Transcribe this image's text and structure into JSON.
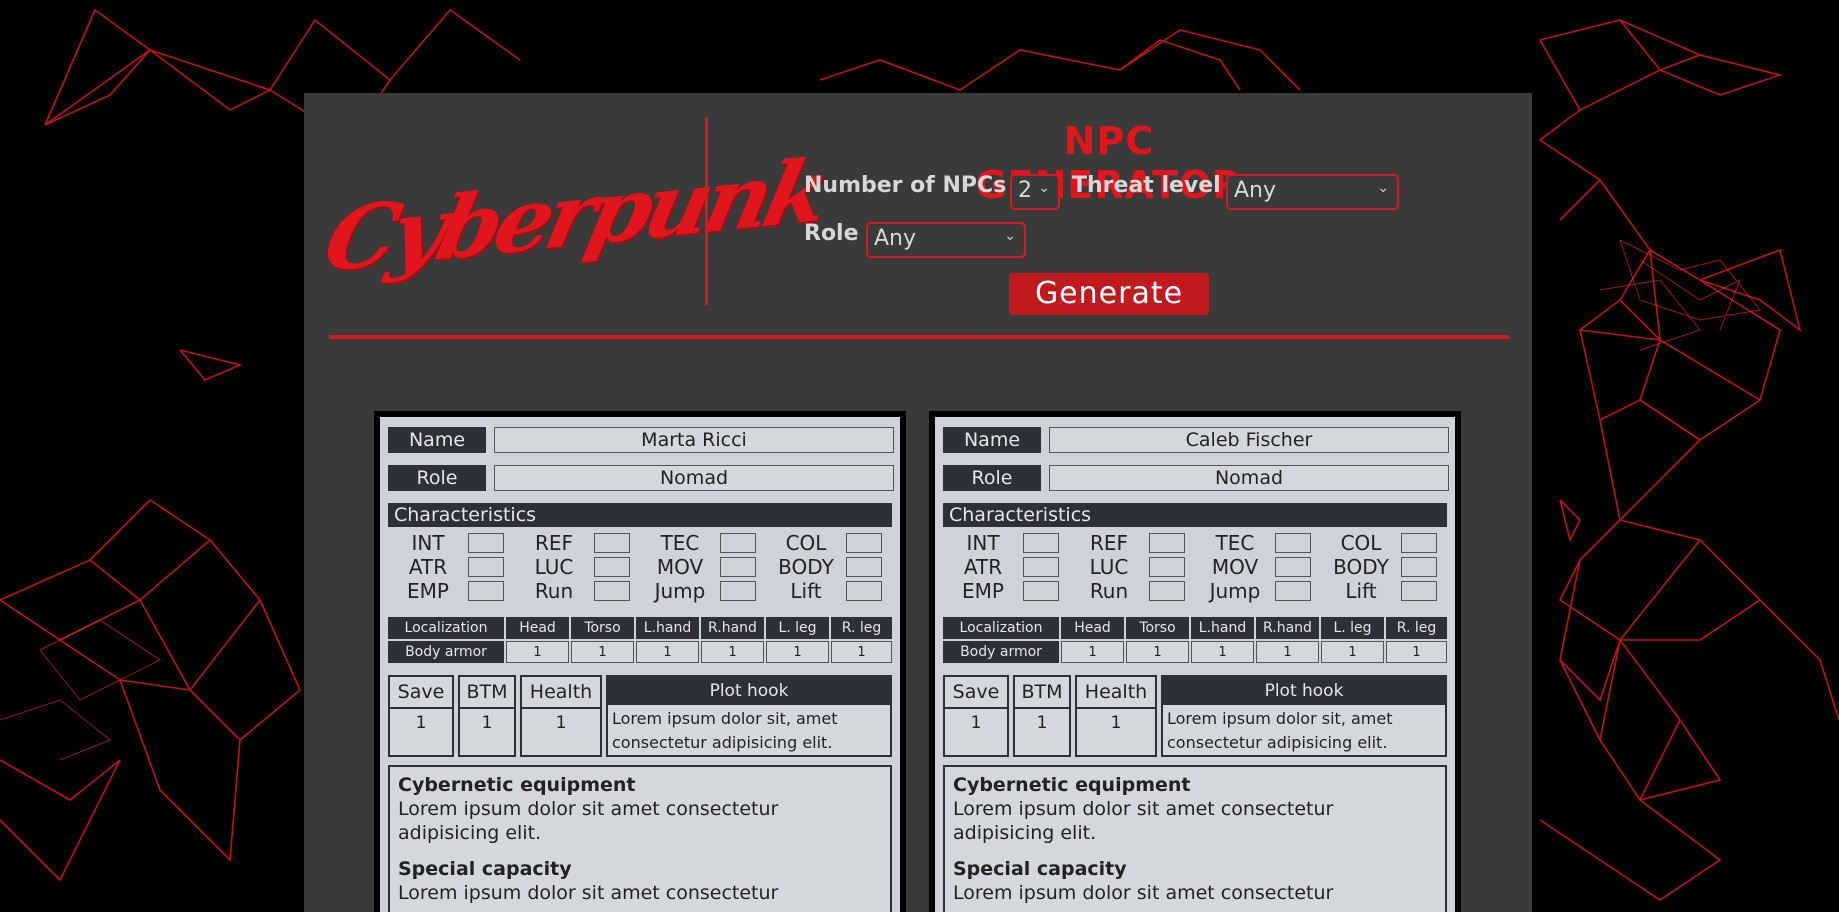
{
  "header": {
    "logo_text": "Cyberpunk",
    "title": "NPC GENERATOR",
    "num_npcs_label": "Number of NPCs",
    "num_npcs_value": "2",
    "threat_label": "Threat level",
    "threat_value": "Any",
    "role_label": "Role",
    "role_value": "Any",
    "generate_label": "Generate"
  },
  "labels": {
    "name": "Name",
    "role": "Role",
    "characteristics": "Characteristics",
    "stats": [
      "INT",
      "REF",
      "TEC",
      "COL",
      "ATR",
      "LUC",
      "MOV",
      "BODY",
      "EMP",
      "Run",
      "Jump",
      "Lift"
    ],
    "localization": "Localization",
    "body_armor": "Body armor",
    "locations": [
      "Head",
      "Torso",
      "L.hand",
      "R.hand",
      "L. leg",
      "R. leg"
    ],
    "save": "Save",
    "btm": "BTM",
    "health": "Health",
    "plot_hook": "Plot hook",
    "cyber_equipment": "Cybernetic equipment",
    "special_capacity": "Special capacity"
  },
  "npcs": [
    {
      "name": "Marta Ricci",
      "role": "Nomad",
      "armor": [
        "1",
        "1",
        "1",
        "1",
        "1",
        "1"
      ],
      "save": "1",
      "btm": "1",
      "health": "1",
      "plot_hook": "Lorem ipsum dolor sit, amet consectetur adipisicing elit.",
      "cyber_equipment": "Lorem ipsum dolor sit amet consectetur adipisicing elit.",
      "special_capacity": "Lorem ipsum dolor sit amet consectetur"
    },
    {
      "name": "Caleb Fischer",
      "role": "Nomad",
      "armor": [
        "1",
        "1",
        "1",
        "1",
        "1",
        "1"
      ],
      "save": "1",
      "btm": "1",
      "health": "1",
      "plot_hook": "Lorem ipsum dolor sit, amet consectetur adipisicing elit.",
      "cyber_equipment": "Lorem ipsum dolor sit amet consectetur adipisicing elit.",
      "special_capacity": "Lorem ipsum dolor sit amet consectetur"
    }
  ],
  "colors": {
    "accent": "#e1161d",
    "panel": "#3a3a3a",
    "card": "#cfd2d8",
    "dark_tag": "#2d3038"
  }
}
